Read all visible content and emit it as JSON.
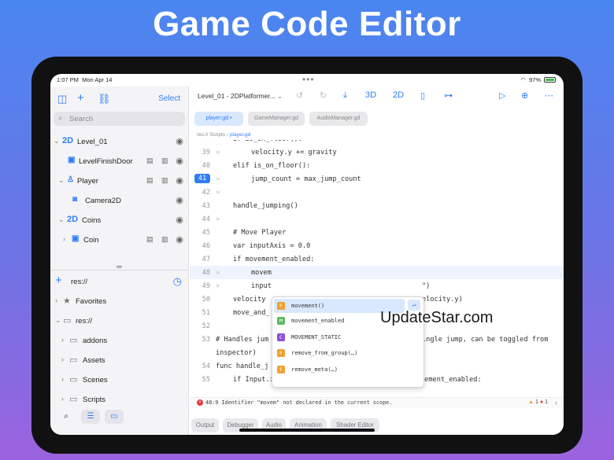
{
  "hero_title": "Game Code Editor",
  "status": {
    "time": "1:07 PM",
    "date": "Mon Apr 14",
    "battery": "97%"
  },
  "sidebar": {
    "select_label": "Select",
    "search_placeholder": "Search",
    "tree": [
      {
        "label": "Level_01",
        "icon": "2D"
      },
      {
        "label": "LevelFinishDoor"
      },
      {
        "label": "Player"
      },
      {
        "label": "Camera2D"
      },
      {
        "label": "Coins",
        "icon": "2D"
      },
      {
        "label": "Coin"
      }
    ],
    "res_path": "res://",
    "favorites": "Favorites",
    "folders": [
      "res://",
      "addons",
      "Assets",
      "Scenes",
      "Scripts"
    ]
  },
  "toolbar": {
    "project": "Level_01 - 2DPlatformer...",
    "btn_3d": "3D",
    "btn_2d": "2D"
  },
  "tabs": [
    "player.gd",
    "GameManager.gd",
    "AudioManager.gd"
  ],
  "breadcrumb": {
    "root": "res:// Scripts",
    "file": "player.gd"
  },
  "code_lines": [
    {
      "n": "39",
      "indent": 2,
      "text": "velocity.y += gravity"
    },
    {
      "n": "40",
      "indent": 1,
      "text": "elif is_on_floor():"
    },
    {
      "n": "41",
      "indent": 2,
      "text": "jump_count = max_jump_count"
    },
    {
      "n": "42",
      "indent": 0,
      "text": ""
    },
    {
      "n": "43",
      "indent": 1,
      "text": "handle_jumping()"
    },
    {
      "n": "44",
      "indent": 0,
      "text": ""
    },
    {
      "n": "45",
      "indent": 1,
      "text": "# Move Player"
    },
    {
      "n": "46",
      "indent": 1,
      "text": "var inputAxis = 0.0"
    },
    {
      "n": "47",
      "indent": 1,
      "text": "if movement_enabled:"
    },
    {
      "n": "48",
      "indent": 2,
      "text": "movem"
    },
    {
      "n": "49",
      "indent": 2,
      "text": "input"
    },
    {
      "n": "50",
      "indent": 1,
      "text": "velocity"
    },
    {
      "n": "51",
      "indent": 1,
      "text": "move_and_"
    },
    {
      "n": "52",
      "indent": 0,
      "text": ""
    },
    {
      "n": "53",
      "indent": 0,
      "text": "# Handles jum"
    },
    {
      "n": "",
      "indent": 0,
      "text": "inspector)"
    },
    {
      "n": "54",
      "indent": 0,
      "text": "func handle_j"
    },
    {
      "n": "55",
      "indent": 1,
      "text": "if Input.is_action_just_pressed(\"Jump\") and movement_enabled:"
    }
  ],
  "code_tail": {
    "l49": "\")",
    "l50": "elocity.y)",
    "l53": "ingle jump, can be toggled from"
  },
  "autocomplete": [
    {
      "badge": "F",
      "color": "#f0a030",
      "text": "movement()"
    },
    {
      "badge": "M",
      "color": "#5cb85c",
      "text": "movement_enabled"
    },
    {
      "badge": "C",
      "color": "#8a4fd6",
      "text": "MOVEMENT_STATIC"
    },
    {
      "badge": "F",
      "color": "#f0a030",
      "text": "remove_from_group(…)"
    },
    {
      "badge": "F",
      "color": "#f0a030",
      "text": "remove_meta(…)"
    }
  ],
  "error": {
    "message": "48:9 Identifier \"movem\" not declared in the current scope.",
    "warnings": "1",
    "errors": "1"
  },
  "bottom_panel": [
    "Output",
    "Debugger",
    "Audio",
    "Animation",
    "Shader Editor"
  ],
  "watermark": "UpdateStar.com"
}
